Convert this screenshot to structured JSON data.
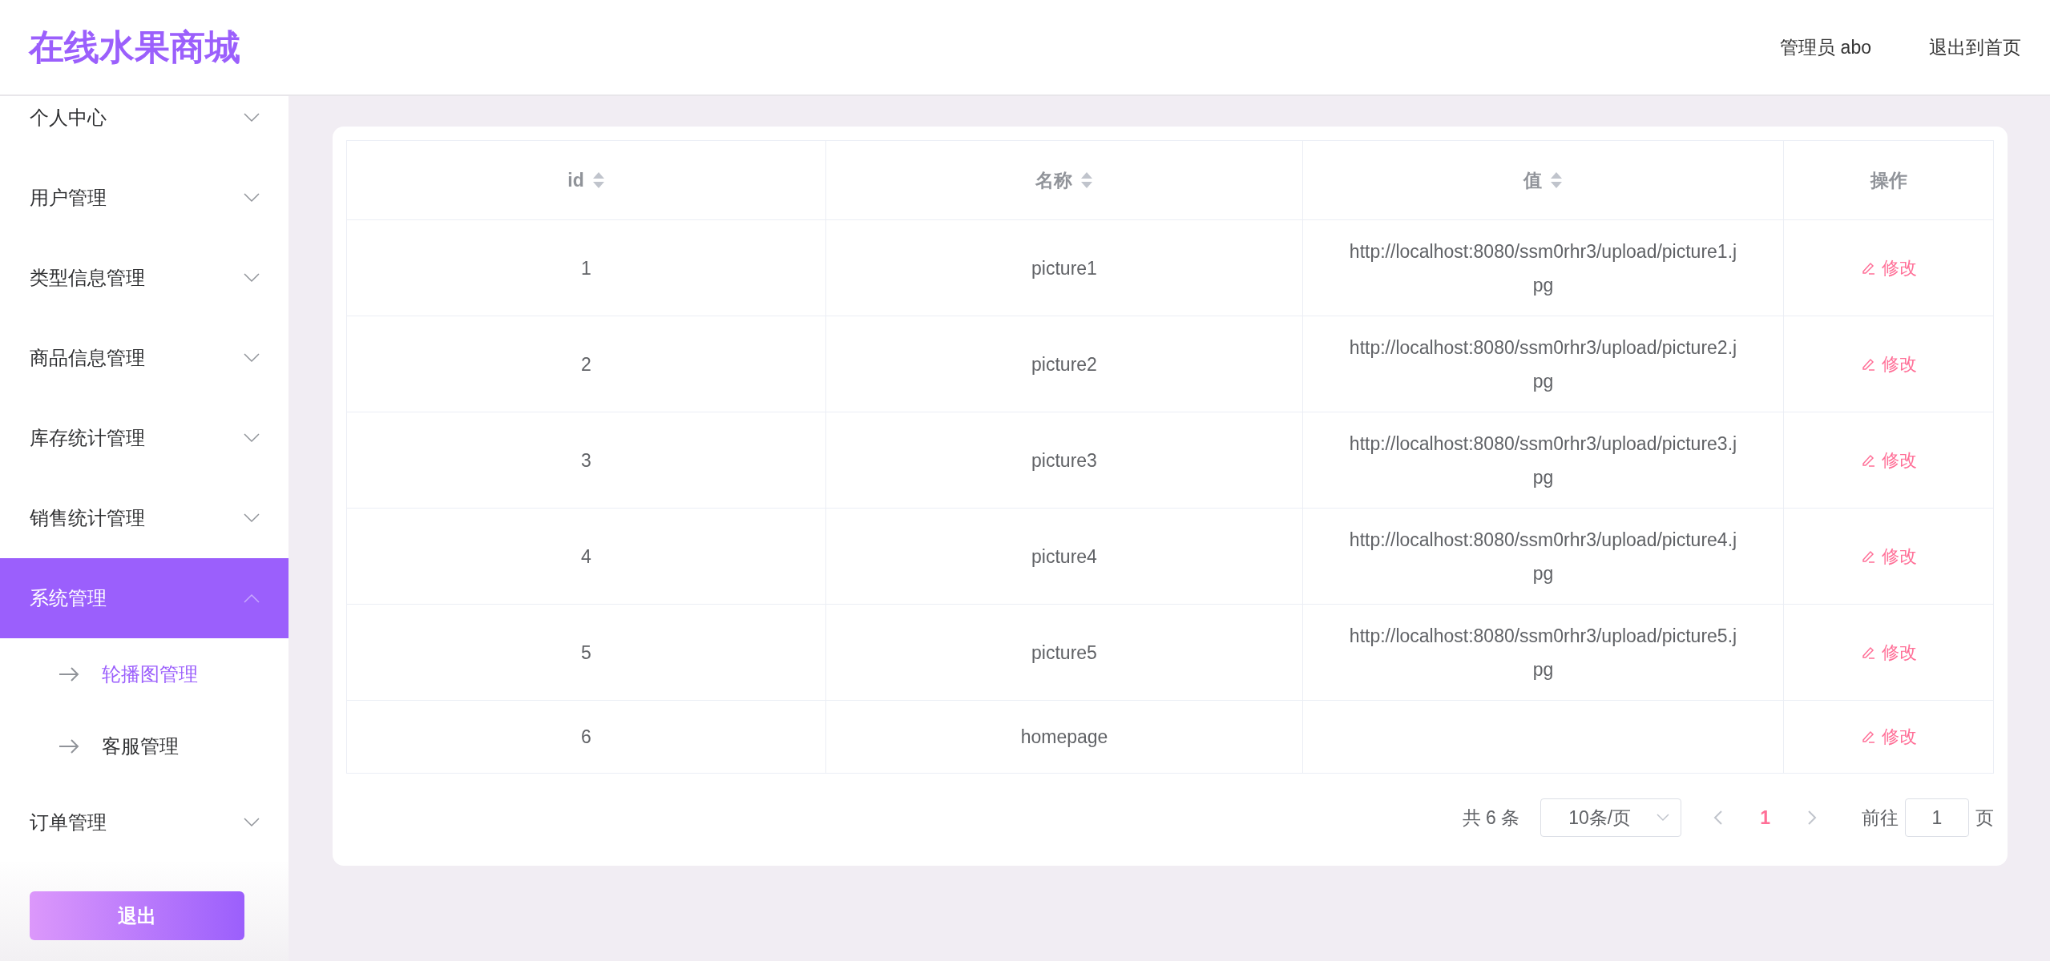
{
  "header": {
    "title": "在线水果商城",
    "user": "管理员 abo",
    "home_link": "退出到首页"
  },
  "sidebar": {
    "items": [
      {
        "label": "个人中心",
        "expanded": false,
        "selected": false
      },
      {
        "label": "用户管理",
        "expanded": false,
        "selected": false
      },
      {
        "label": "类型信息管理",
        "expanded": false,
        "selected": false
      },
      {
        "label": "商品信息管理",
        "expanded": false,
        "selected": false
      },
      {
        "label": "库存统计管理",
        "expanded": false,
        "selected": false
      },
      {
        "label": "销售统计管理",
        "expanded": false,
        "selected": false
      },
      {
        "label": "系统管理",
        "expanded": true,
        "selected": true,
        "children": [
          {
            "label": "轮播图管理",
            "selected": true
          },
          {
            "label": "客服管理",
            "selected": false
          }
        ]
      },
      {
        "label": "订单管理",
        "expanded": false,
        "selected": false
      }
    ],
    "logout_button": "退出"
  },
  "table": {
    "columns": [
      {
        "label": "id",
        "sortable": true
      },
      {
        "label": "名称",
        "sortable": true
      },
      {
        "label": "值",
        "sortable": true
      },
      {
        "label": "操作",
        "sortable": false
      }
    ],
    "rows": [
      {
        "id": "1",
        "name": "picture1",
        "value": "http://localhost:8080/ssm0rhr3/upload/picture1.jpg",
        "action": "修改"
      },
      {
        "id": "2",
        "name": "picture2",
        "value": "http://localhost:8080/ssm0rhr3/upload/picture2.jpg",
        "action": "修改"
      },
      {
        "id": "3",
        "name": "picture3",
        "value": "http://localhost:8080/ssm0rhr3/upload/picture3.jpg",
        "action": "修改"
      },
      {
        "id": "4",
        "name": "picture4",
        "value": "http://localhost:8080/ssm0rhr3/upload/picture4.jpg",
        "action": "修改"
      },
      {
        "id": "5",
        "name": "picture5",
        "value": "http://localhost:8080/ssm0rhr3/upload/picture5.jpg",
        "action": "修改"
      },
      {
        "id": "6",
        "name": "homepage",
        "action": "修改"
      }
    ]
  },
  "pagination": {
    "total": "共 6 条",
    "page_size": "10条/页",
    "pages": [
      {
        "label": "1",
        "selected": true
      }
    ],
    "goto_label": "前往",
    "goto_value": "1",
    "goto_suffix": "页"
  }
}
